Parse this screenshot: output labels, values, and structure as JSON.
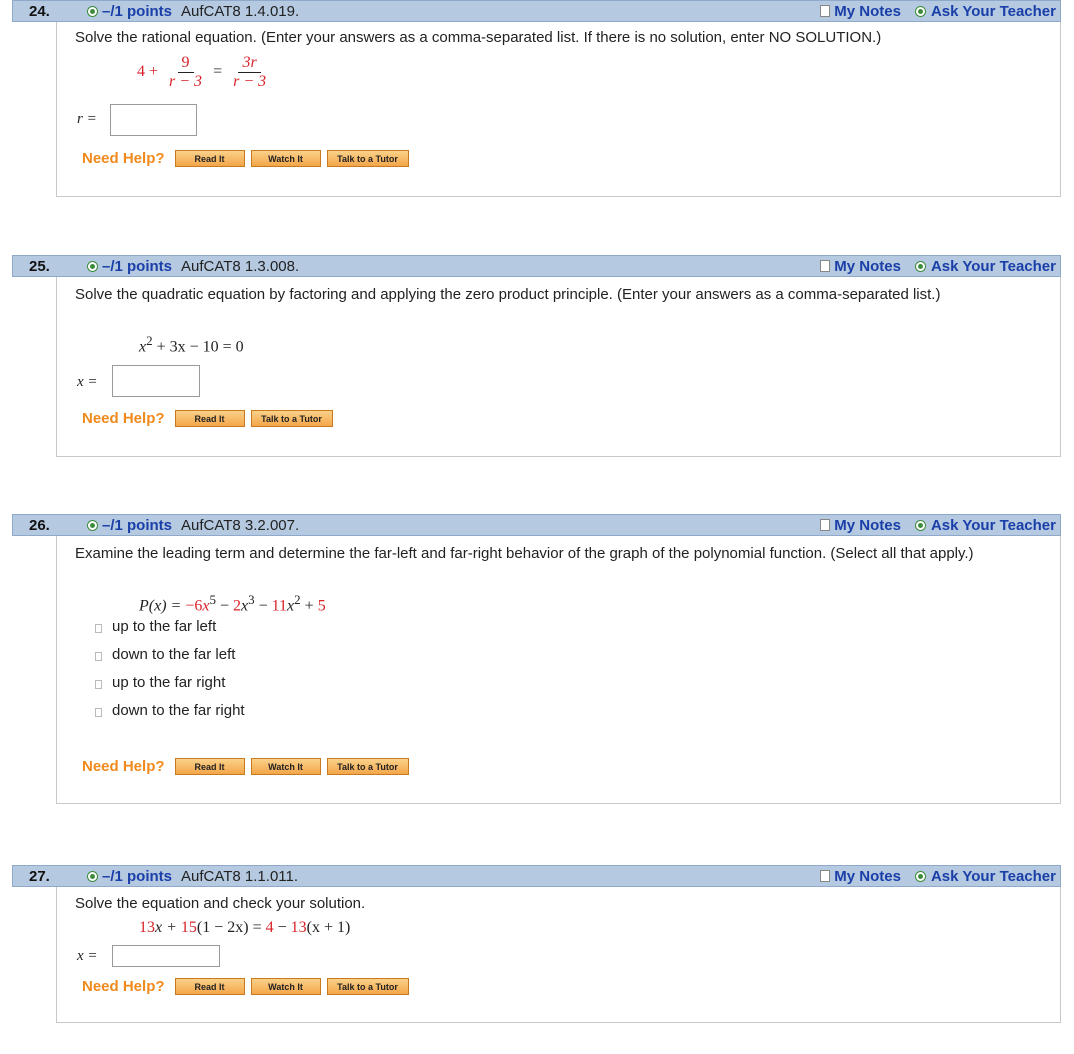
{
  "common": {
    "my_notes": "My Notes",
    "ask_teacher": "Ask Your Teacher",
    "need_help": "Need Help?",
    "read_it": "Read It",
    "watch_it": "Watch It",
    "talk_tutor": "Talk to a Tutor"
  },
  "questions": [
    {
      "number": "24.",
      "points": "–/1 points",
      "id": "AufCAT8 1.4.019.",
      "prompt": "Solve the rational equation. (Enter your answers as a comma-separated list. If there is no solution, enter NO SOLUTION.)",
      "equation": {
        "lhs_const": "4 +",
        "frac1_num": "9",
        "frac1_den": "r − 3",
        "equals": "=",
        "frac2_num": "3r",
        "frac2_den": "r − 3"
      },
      "answer_label": "r =",
      "answer_value": ""
    },
    {
      "number": "25.",
      "points": "–/1 points",
      "id": "AufCAT8 1.3.008.",
      "prompt": "Solve the quadratic equation by factoring and applying the zero product principle. (Enter your answers as a comma-separated list.)",
      "equation": {
        "base": "x",
        "exp": "2",
        "rest": " + 3x − 10 = 0"
      },
      "answer_label": "x =",
      "answer_value": ""
    },
    {
      "number": "26.",
      "points": "–/1 points",
      "id": "AufCAT8 3.2.007.",
      "prompt": "Examine the leading term and determine the far-left and far-right behavior of the graph of the polynomial function. (Select all that apply.)",
      "equation": {
        "lhs": "P(x) =",
        "t1": "−6",
        "t1v": "x",
        "t1e": "5",
        "op1": "−",
        "t2": "2",
        "t2v": "x",
        "t2e": "3",
        "op2": "−",
        "t3": "11",
        "t3v": "x",
        "t3e": "2",
        "op3": "+",
        "t4": "5"
      },
      "options": [
        "up to the far left",
        "down to the far left",
        "up to the far right",
        "down to the far right"
      ]
    },
    {
      "number": "27.",
      "points": "–/1 points",
      "id": "AufCAT8 1.1.011.",
      "prompt": "Solve the equation and check your solution.",
      "equation": {
        "a": "13",
        "b": "x + ",
        "c": "15",
        "d": "(1 − 2x) = ",
        "e": "4",
        "f": " − ",
        "g": "13",
        "h": "(x + 1)"
      },
      "answer_label": "x =",
      "answer_value": ""
    }
  ]
}
